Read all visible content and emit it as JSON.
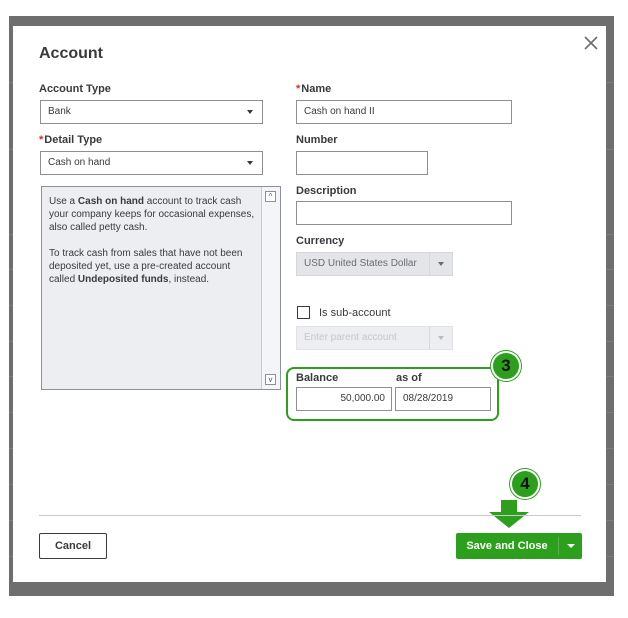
{
  "dialog": {
    "title": "Account"
  },
  "form": {
    "account_type": {
      "label": "Account Type",
      "value": "Bank"
    },
    "name": {
      "label": "Name",
      "required_mark": "*",
      "value": "Cash on hand II"
    },
    "detail_type": {
      "label": "Detail Type",
      "required_mark": "*",
      "value": "Cash on hand"
    },
    "number": {
      "label": "Number",
      "value": ""
    },
    "description": {
      "label": "Description",
      "value": ""
    },
    "currency": {
      "label": "Currency",
      "value": "USD United States Dollar"
    },
    "sub_account": {
      "label": "Is sub-account",
      "checked": false
    },
    "parent_account": {
      "placeholder": "Enter parent account"
    },
    "balance": {
      "label": "Balance",
      "value": "50,000.00"
    },
    "as_of": {
      "label": "as of",
      "value": "08/28/2019"
    }
  },
  "detail_description": {
    "p1_pre": "Use a ",
    "p1_bold": "Cash on hand",
    "p1_post": " account to track cash your company keeps for occasional expenses, also called petty cash.",
    "p2_pre": "To track cash from sales that have not been deposited yet, use a pre-created account called ",
    "p2_bold": "Undeposited funds",
    "p2_post": ", instead."
  },
  "footer": {
    "cancel_label": "Cancel",
    "save_label": "Save and Close"
  },
  "annotations": {
    "step_3": "3",
    "step_4": "4"
  },
  "colors": {
    "accent_green": "#2ca01c",
    "required_red": "#d52b1e",
    "text": "#393a3d"
  },
  "icons": {
    "close": "close-icon",
    "dropdown": "chevron-down-icon",
    "scroll_up": "scroll-up-icon",
    "scroll_down": "scroll-down-icon",
    "arrow": "down-arrow-icon"
  }
}
